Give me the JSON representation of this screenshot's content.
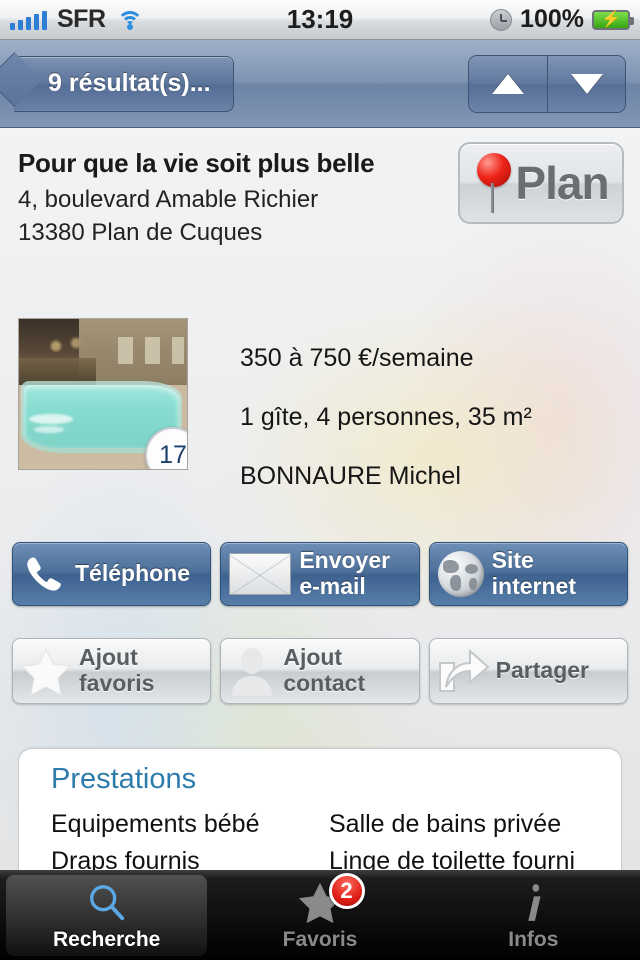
{
  "status_bar": {
    "carrier": "SFR",
    "signal_icon": "signal-bars-icon",
    "wifi_icon": "wifi-icon",
    "time": "13:19",
    "alarm_icon": "clock-icon",
    "battery_percent": "100%",
    "battery_icon": "battery-charging-icon"
  },
  "nav_bar": {
    "back_label": "9 résultat(s)...",
    "prev_icon": "triangle-up-icon",
    "next_icon": "triangle-down-icon"
  },
  "listing": {
    "title": "Pour que la vie soit plus belle",
    "address_line1": "4, boulevard Amable Richier",
    "address_line2": "13380  Plan de Cuques",
    "map_button_label": "Plan",
    "map_pin_icon": "map-pin-icon",
    "photo_count": "17",
    "price": "350 à 750 €/semaine",
    "capacity": "1 gîte, 4 personnes, 35 m²",
    "owner": "BONNAURE Michel"
  },
  "actions": {
    "primary": [
      {
        "label_line1": "Téléphone",
        "label_line2": "",
        "icon": "phone-icon",
        "name": "phone-button"
      },
      {
        "label_line1": "Envoyer",
        "label_line2": "e-mail",
        "icon": "envelope-icon",
        "name": "email-button"
      },
      {
        "label_line1": "Site",
        "label_line2": "internet",
        "icon": "globe-icon",
        "name": "website-button"
      }
    ],
    "secondary": [
      {
        "label_line1": "Ajout",
        "label_line2": "favoris",
        "icon": "star-icon",
        "name": "add-favorite-button"
      },
      {
        "label_line1": "Ajout",
        "label_line2": "contact",
        "icon": "person-icon",
        "name": "add-contact-button"
      },
      {
        "label_line1": "Partager",
        "label_line2": "",
        "icon": "share-icon",
        "name": "share-button"
      }
    ]
  },
  "prestations": {
    "heading": "Prestations",
    "rows": [
      {
        "left": "Equipements bébé",
        "right": "Salle de bains privée"
      },
      {
        "left": "Draps fournis",
        "right": "Linge de toilette fourni"
      }
    ]
  },
  "tab_bar": {
    "tabs": [
      {
        "label": "Recherche",
        "icon": "magnifier-icon",
        "badge": "",
        "active": true
      },
      {
        "label": "Favoris",
        "icon": "star-icon",
        "badge": "2",
        "active": false
      },
      {
        "label": "Infos",
        "icon": "info-icon",
        "badge": "",
        "active": false
      }
    ]
  },
  "colors": {
    "accent_blue": "#2d7cad",
    "button_blue": "#4d7099",
    "badge_red": "#e01f17",
    "pin_red": "#ee2418"
  }
}
